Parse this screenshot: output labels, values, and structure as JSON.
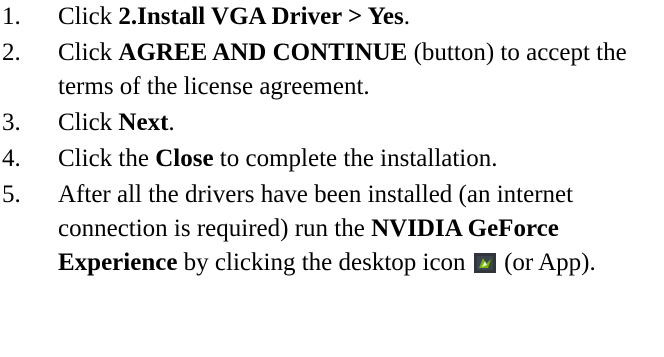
{
  "steps": [
    {
      "number": "1.",
      "pre": "Click ",
      "bold": "2.Install VGA Driver > Yes",
      "post": "."
    },
    {
      "number": "2.",
      "pre": "Click ",
      "bold": "AGREE AND CONTINUE",
      "post": " (button) to accept the terms of the license agreement."
    },
    {
      "number": "3.",
      "pre": "Click ",
      "bold": "Next",
      "post": "."
    },
    {
      "number": "4.",
      "pre": "Click the ",
      "bold": "Close",
      "post": " to complete the installation."
    },
    {
      "number": "5.",
      "pre": "After all the drivers have been installed (an internet connection is required) run the ",
      "bold": "NVIDIA GeForce Experience",
      "mid": " by clicking the desktop icon ",
      "icon": "geforce-experience-icon",
      "post": " (or App)."
    }
  ]
}
